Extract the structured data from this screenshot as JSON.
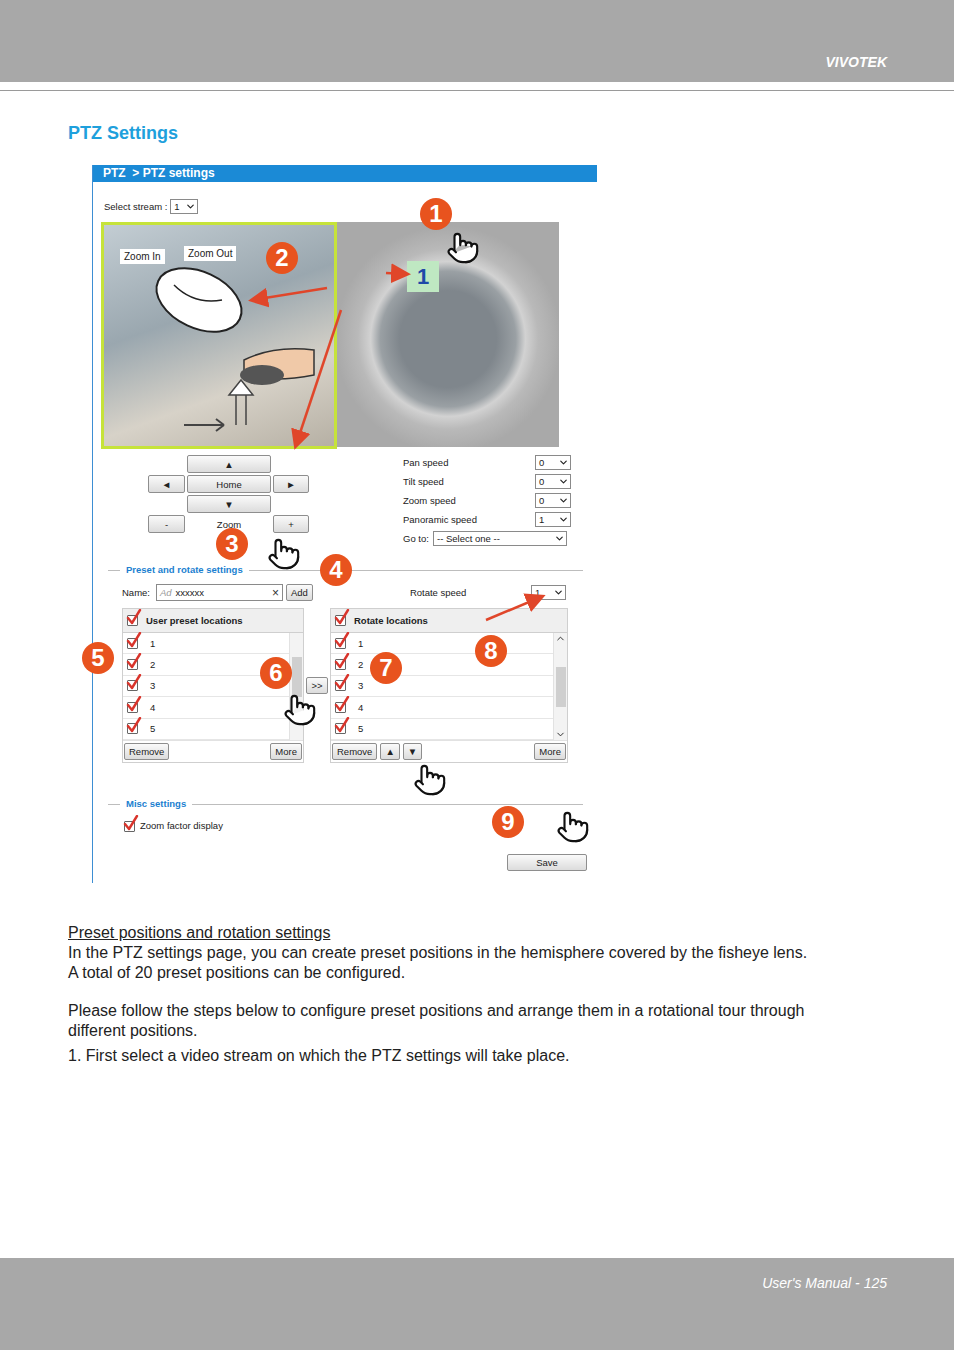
{
  "header": {
    "brand": "VIVOTEK"
  },
  "heading": "PTZ Settings",
  "screenshot": {
    "title": "PTZ  > PTZ settings",
    "stream": {
      "label": "Select stream :",
      "value": "1"
    },
    "zoom_labels": [
      "Zoom In",
      "Zoom Out"
    ],
    "fisheye_marker": "1",
    "nav": {
      "up": "▲",
      "left": "◄",
      "home": "Home",
      "right": "►",
      "down": "▼",
      "minus": "-",
      "zoom": "Zoom",
      "plus": "+"
    },
    "speeds": [
      {
        "label": "Pan speed",
        "value": "0"
      },
      {
        "label": "Tilt speed",
        "value": "0"
      },
      {
        "label": "Zoom speed",
        "value": "0"
      },
      {
        "label": "Panoramic speed",
        "value": "1"
      }
    ],
    "goto": {
      "label": "Go to:",
      "value": "-- Select one --"
    },
    "preset_section": {
      "legend": "Preset and rotate settings",
      "name_label": "Name:",
      "placeholder": "Ad",
      "value": "xxxxxx",
      "clear": "×",
      "add": "Add",
      "rotate_speed_label": "Rotate speed",
      "rotate_speed": "1"
    },
    "preset_list": {
      "header": "User preset locations",
      "header_checked": true,
      "items": [
        {
          "label": "1",
          "checked": true
        },
        {
          "label": "2",
          "checked": true
        },
        {
          "label": "3",
          "checked": true
        },
        {
          "label": "4",
          "checked": true
        },
        {
          "label": "5",
          "checked": true
        }
      ],
      "buttons": [
        "Remove",
        "More"
      ]
    },
    "move_button": ">>",
    "rotate_list": {
      "header": "Rotate locations",
      "header_checked": true,
      "items": [
        {
          "label": "1",
          "checked": true
        },
        {
          "label": "2",
          "checked": true
        },
        {
          "label": "3",
          "checked": true
        },
        {
          "label": "4",
          "checked": true
        },
        {
          "label": "5",
          "checked": true
        }
      ],
      "buttons": [
        "Remove",
        "▲",
        "▼",
        "More"
      ]
    },
    "misc": {
      "legend": "Misc settings",
      "option": {
        "label": "Zoom factor display",
        "checked": true
      }
    },
    "save": "Save",
    "callouts": [
      "1",
      "2",
      "3",
      "4",
      "5",
      "6",
      "7",
      "8",
      "9"
    ]
  },
  "body": {
    "subtitle": "Preset positions and rotation settings",
    "paragraphs": [
      [
        "In the PTZ settings page, you can create preset positions in the hemisphere covered by the fisheye lens.",
        "A total of 20 preset positions can be configured."
      ],
      [
        "Please follow the steps below to configure preset positions and arrange them in a rotational tour through",
        "different positions."
      ],
      [
        "1. First select a video stream on which the PTZ settings will take place."
      ]
    ]
  },
  "footer": {
    "page": "User's Manual - 125"
  }
}
